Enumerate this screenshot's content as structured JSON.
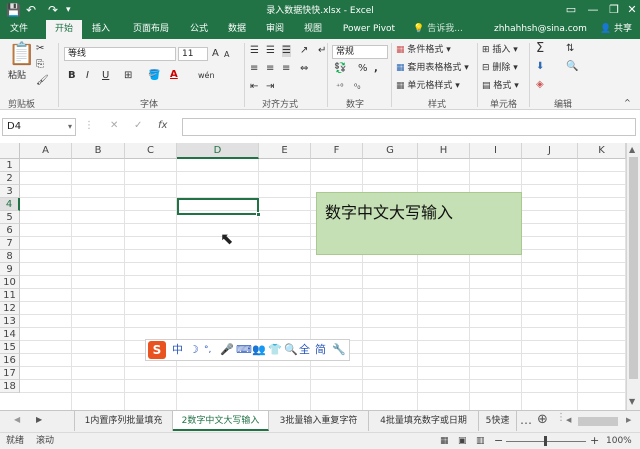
{
  "titlebar": {
    "title": "录入数据快快.xlsx - Excel",
    "save_icon": "save-icon",
    "undo": "↶",
    "redo": "↷",
    "minimize": "—",
    "restore": "❐",
    "close": "✕"
  },
  "tabs": [
    "文件",
    "开始",
    "插入",
    "页面布局",
    "公式",
    "数据",
    "审阅",
    "视图",
    "Power Pivot",
    "告诉我...",
    "zhhahhsh@sina.com",
    "共享"
  ],
  "ribbon": {
    "clipboard": {
      "paste": "粘贴",
      "label": "剪贴板"
    },
    "font": {
      "name": "等线",
      "size": "11",
      "bold": "B",
      "italic": "I",
      "underline": "U",
      "font_color": "A",
      "phonetic": "wén",
      "grow": "A",
      "shrink": "A",
      "label": "字体"
    },
    "align": {
      "label": "对齐方式"
    },
    "number": {
      "format": "常规",
      "percent": "%",
      "comma": ",",
      "label": "数字"
    },
    "styles": {
      "conditional": "条件格式 ▾",
      "table": "套用表格格式 ▾",
      "cell": "单元格样式 ▾",
      "label": "样式"
    },
    "cells": {
      "insert": "插入",
      "delete": "删除",
      "format": "格式",
      "label": "单元格"
    },
    "editing": {
      "sum": "Σ",
      "label": "编辑"
    }
  },
  "formula_bar": {
    "name_box": "D4",
    "cancel": "✕",
    "confirm": "✓",
    "fx": "fx",
    "value": ""
  },
  "grid": {
    "columns": [
      "A",
      "B",
      "C",
      "D",
      "E",
      "F",
      "G",
      "H",
      "I",
      "J",
      "K"
    ],
    "rows": [
      "1",
      "2",
      "3",
      "4",
      "5",
      "6",
      "7",
      "8",
      "9",
      "10",
      "11",
      "12",
      "13",
      "14",
      "15",
      "16",
      "17",
      "18"
    ],
    "selected_col": "D",
    "selected_row": "4",
    "textbox": "数字中文大写输入"
  },
  "ime": {
    "logo": "S",
    "items": [
      "中",
      "☽",
      "°,",
      "🎤",
      "⌨",
      "👕",
      "🔍",
      "全",
      "简",
      "🔧"
    ]
  },
  "sheet_tabs": [
    "1内置序列批量填充",
    "2数字中文大写输入",
    "3批量输入重复字符",
    "4批量填充数字或日期",
    "5快速"
  ],
  "active_sheet": 1,
  "status": {
    "ready": "就绪",
    "scroll": "滚动",
    "zoom": "100%",
    "minus": "−",
    "plus": "+"
  }
}
